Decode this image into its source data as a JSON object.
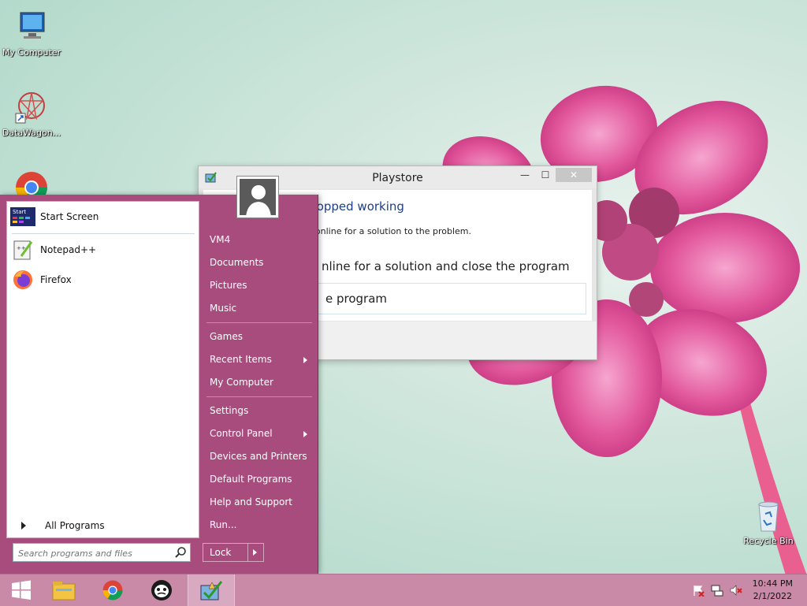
{
  "desktop": {
    "icons": [
      {
        "label": "My Computer",
        "icon": "computer-icon"
      },
      {
        "label": "DataWagon...",
        "icon": "datawagon-icon"
      },
      {
        "label": "",
        "icon": "chrome-icon"
      },
      {
        "label": "Recycle Bin",
        "icon": "recycle-bin-icon"
      }
    ]
  },
  "dialog": {
    "title": "Playstore",
    "headline": "stopped working",
    "subtext": "ck online for a solution to the problem.",
    "option_check": "nline for a solution and close the program",
    "option_close": "e program",
    "controls": {
      "minimize": "—",
      "maximize": "☐",
      "close": "✕"
    }
  },
  "start_menu": {
    "left_items": [
      {
        "label": "Start Screen",
        "icon": "start-screen-icon"
      },
      {
        "label": "Notepad++",
        "icon": "notepadpp-icon"
      },
      {
        "label": "Firefox",
        "icon": "firefox-icon"
      }
    ],
    "all_programs": "All Programs",
    "search": {
      "placeholder": "Search programs and files",
      "value": ""
    },
    "right_items": [
      {
        "label": "VM4",
        "submenu": false
      },
      {
        "label": "Documents",
        "submenu": false
      },
      {
        "label": "Pictures",
        "submenu": false
      },
      {
        "label": "Music",
        "submenu": false
      },
      {
        "label": "Games",
        "submenu": false
      },
      {
        "label": "Recent Items",
        "submenu": true
      },
      {
        "label": "My Computer",
        "submenu": false
      },
      {
        "label": "Settings",
        "submenu": false
      },
      {
        "label": "Control Panel",
        "submenu": true
      },
      {
        "label": "Devices and Printers",
        "submenu": false
      },
      {
        "label": "Default Programs",
        "submenu": false
      },
      {
        "label": "Help and Support",
        "submenu": false
      },
      {
        "label": "Run...",
        "submenu": false
      }
    ],
    "lock_label": "Lock"
  },
  "taskbar": {
    "items": [
      {
        "icon": "windows-start-icon"
      },
      {
        "icon": "file-explorer-icon"
      },
      {
        "icon": "chrome-icon"
      },
      {
        "icon": "ghost-app-icon"
      },
      {
        "icon": "playstore-app-icon",
        "active": true
      }
    ],
    "tray": [
      {
        "icon": "action-center-flag-icon"
      },
      {
        "icon": "network-icon"
      },
      {
        "icon": "volume-muted-icon"
      }
    ],
    "clock": {
      "time": "10:44 PM",
      "date": "2/1/2022"
    }
  },
  "colors": {
    "start_menu_bg": "#a74c7c",
    "taskbar_bg": "#c98aa8",
    "dialog_headline": "#1c3f86"
  }
}
